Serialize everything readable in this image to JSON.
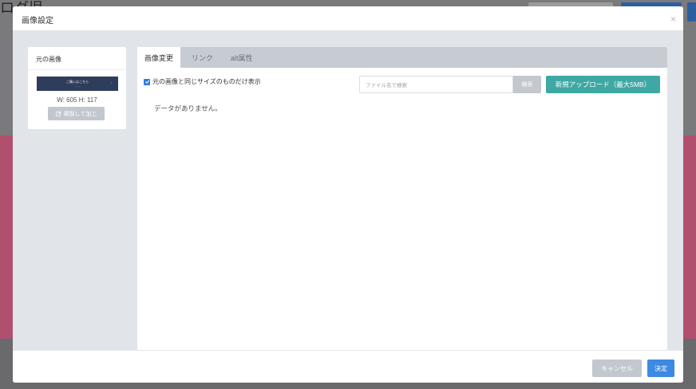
{
  "background": {
    "page_title": "ログ児"
  },
  "modal": {
    "title": "画像設定",
    "close_icon": "close-icon",
    "close_symbol": "×"
  },
  "original": {
    "title": "元の画像",
    "thumb_text": "ご購入はこちら",
    "thumb_subtext": "— —",
    "thumb_arrow": "›",
    "dimensions": "W: 605  H: 117",
    "copy_button": "複製して加工"
  },
  "tabs": [
    {
      "label": "画像変更",
      "active": true
    },
    {
      "label": "リンク",
      "active": false
    },
    {
      "label": "alt属性",
      "active": false
    }
  ],
  "filter": {
    "checkbox_label": "元の画像と同じサイズのものだけ表示",
    "checked": true
  },
  "search": {
    "placeholder": "ファイル名で検索",
    "button": "検索"
  },
  "upload_button": "新規アップロード（最大5MB）",
  "empty_message": "データがありません。",
  "footer": {
    "cancel": "キャンセル",
    "ok": "決定"
  },
  "colors": {
    "primary": "#3d8ae2",
    "teal": "#3fa8a4",
    "disabled": "#c3c8cf",
    "backdrop_pink": "#b0506e"
  }
}
